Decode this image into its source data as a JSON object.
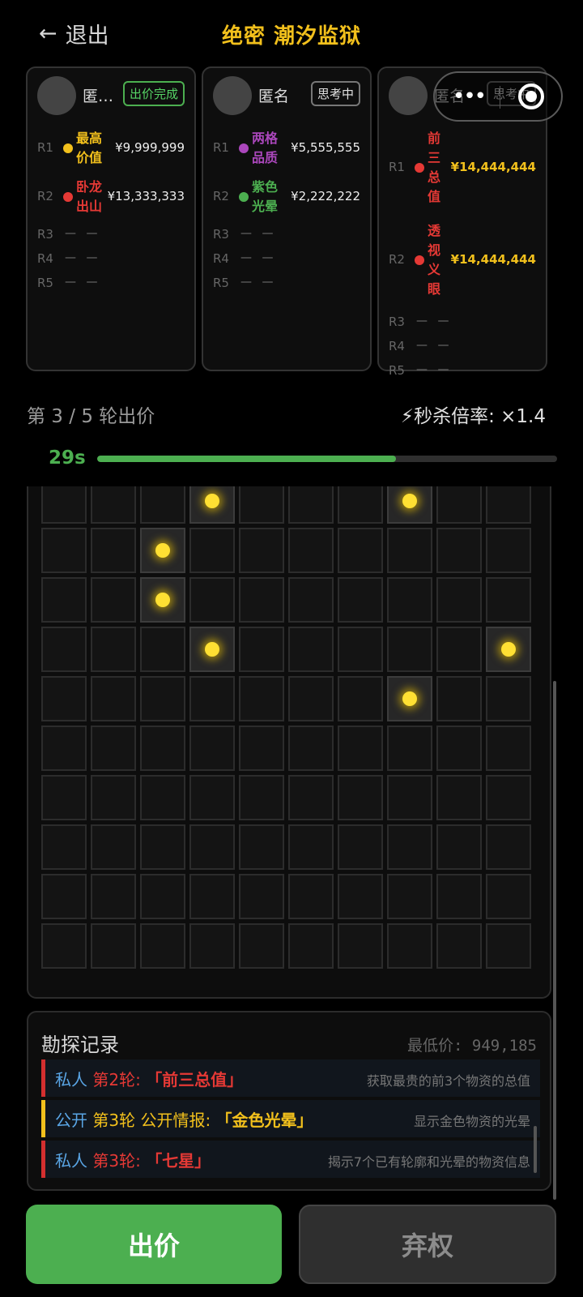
{
  "header": {
    "back_arrow": "←",
    "back_label": "退出",
    "title": "绝密 潮汐监狱"
  },
  "capsule": {
    "more_icon": "•••",
    "record_icon": "record-target"
  },
  "players": [
    {
      "name": "匿…",
      "status": "出价完成",
      "status_type": "done",
      "bids": [
        {
          "round": "R1",
          "dot_color": "#f2c01c",
          "name_lines": [
            "最高",
            "价值"
          ],
          "name_color": "#f2c01c",
          "value": "¥9,999,999"
        },
        {
          "round": "R2",
          "dot_color": "#e53935",
          "name_lines": [
            "卧龙",
            "出山"
          ],
          "name_color": "#e53935",
          "value": "¥13,333,333"
        }
      ],
      "empty_rounds": [
        "R3",
        "R4",
        "R5"
      ],
      "empty_mark": "— —"
    },
    {
      "name": "匿名",
      "status": "思考中",
      "status_type": "thinking",
      "bids": [
        {
          "round": "R1",
          "dot_color": "#ab47bc",
          "name_lines": [
            "两格",
            "品质"
          ],
          "name_color": "#ab47bc",
          "value": "¥5,555,555"
        },
        {
          "round": "R2",
          "dot_color": "#4caf50",
          "name_lines": [
            "紫色",
            "光晕"
          ],
          "name_color": "#4caf50",
          "value": "¥2,222,222"
        }
      ],
      "empty_rounds": [
        "R3",
        "R4",
        "R5"
      ],
      "empty_mark": "— —"
    },
    {
      "name": "匿名",
      "status": "思考中",
      "status_type": "thinking",
      "bids": [
        {
          "round": "R1",
          "dot_color": "#e53935",
          "name_lines": [
            "前",
            "三",
            "总",
            "值"
          ],
          "name_color": "#e53935",
          "value": "¥14,444,444"
        },
        {
          "round": "R2",
          "dot_color": "#e53935",
          "name_lines": [
            "透",
            "视",
            "义",
            "眼"
          ],
          "name_color": "#e53935",
          "value": "¥14,444,444"
        }
      ],
      "empty_rounds": [
        "R3",
        "R4",
        "R5"
      ],
      "empty_mark": "— —"
    }
  ],
  "round": {
    "text": "第 3 / 5 轮出价",
    "mult_icon": "⚡",
    "mult_text": "秒杀倍率: ×1.4"
  },
  "timer": {
    "label": "29s",
    "progress": 0.65
  },
  "grid": {
    "cols": 10,
    "rows": 10,
    "lit": [
      [
        0,
        3
      ],
      [
        0,
        7
      ],
      [
        1,
        2
      ],
      [
        2,
        2
      ],
      [
        3,
        3
      ],
      [
        3,
        9
      ],
      [
        4,
        7
      ]
    ]
  },
  "records": {
    "title": "勘探记录",
    "min_price": "最低价: 949,185",
    "items": [
      {
        "type": "私人",
        "type_color": "blue",
        "round": "第2轮:",
        "round_color": "red",
        "clue": "「前三总值」",
        "clue_color": "red",
        "desc": "获取最贵的前3个物资的总值",
        "bar": "red"
      },
      {
        "type": "公开",
        "type_color": "blue",
        "round": "第3轮 公开情报:",
        "round_color": "ylw",
        "clue": "「金色光晕」",
        "clue_color": "ylw",
        "desc": "显示金色物资的光晕",
        "bar": "yellow"
      },
      {
        "type": "私人",
        "type_color": "blue",
        "round": "第3轮:",
        "round_color": "red",
        "clue": "「七星」",
        "clue_color": "red",
        "desc": "揭示7个已有轮廓和光晕的物资信息",
        "bar": "red"
      }
    ]
  },
  "actions": {
    "bid": "出价",
    "giveup": "弃权"
  }
}
